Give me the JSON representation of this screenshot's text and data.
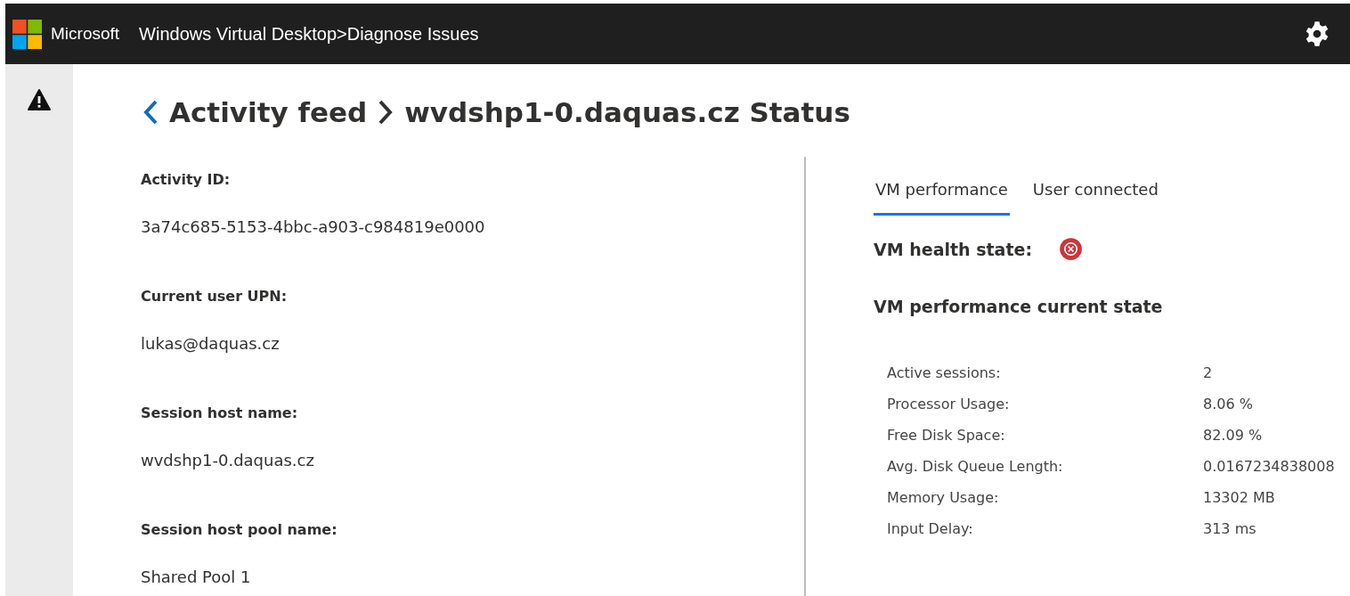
{
  "header": {
    "brand": "Microsoft",
    "title": "Windows Virtual Desktop>Diagnose Issues"
  },
  "breadcrumb": {
    "back": "Activity feed",
    "current": "wvdshp1-0.daquas.cz Status"
  },
  "details": [
    {
      "label": "Activity ID:",
      "value": "3a74c685-5153-4bbc-a903-c984819e0000"
    },
    {
      "label": "Current user UPN:",
      "value": "lukas@daquas.cz"
    },
    {
      "label": "Session host name:",
      "value": "wvdshp1-0.daquas.cz"
    },
    {
      "label": "Session host pool name:",
      "value": "Shared Pool 1"
    }
  ],
  "tabs": [
    {
      "label": "VM performance",
      "selected": true
    },
    {
      "label": "User connected",
      "selected": false
    }
  ],
  "health": {
    "label": "VM health state:",
    "healthy": false
  },
  "performance": {
    "heading": "VM performance current state",
    "metrics": [
      {
        "label": "Active sessions:",
        "value": "2"
      },
      {
        "label": "Processor Usage:",
        "value": "8.06 %"
      },
      {
        "label": "Free Disk Space:",
        "value": "82.09 %"
      },
      {
        "label": "Avg. Disk Queue Length:",
        "value": "0.0167234838008"
      },
      {
        "label": "Memory Usage:",
        "value": "13302 MB"
      },
      {
        "label": "Input Delay:",
        "value": "313 ms"
      }
    ]
  }
}
